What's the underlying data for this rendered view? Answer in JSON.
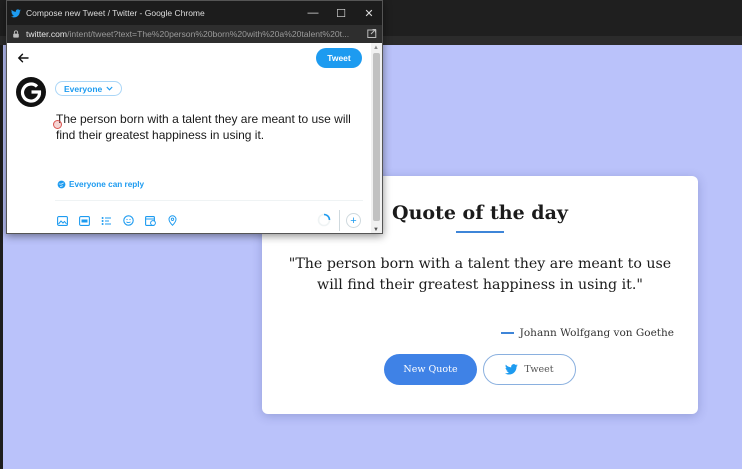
{
  "popup": {
    "window_title": "Compose new Tweet / Twitter - Google Chrome",
    "window_controls": {
      "minimize": "—",
      "maximize": "☐",
      "close": "✕"
    },
    "url_host": "twitter.com",
    "url_rest": "/intent/tweet?text=The%20person%20born%20with%20a%20talent%20t...",
    "tweet_button_label": "Tweet",
    "audience_label": "Everyone",
    "compose_text": "The person born with a talent they are meant to use will find their greatest happiness in using it.",
    "reply_setting_label": "Everyone can reply",
    "toolbar_icons": [
      "image-icon",
      "gif-icon",
      "poll-icon",
      "emoji-icon",
      "schedule-icon",
      "location-icon"
    ],
    "add_label": "+"
  },
  "quote_card": {
    "title": "Quote of the day",
    "quote": "\"The person born with a talent they are meant to use will find their greatest happiness in using it.\"",
    "author": "Johann Wolfgang von Goethe",
    "new_quote_label": "New Quote",
    "tweet_label": "Tweet"
  },
  "colors": {
    "page_background": "#bac2fa",
    "accent_blue": "#3f82e6",
    "twitter_blue": "#1d9bf0"
  }
}
